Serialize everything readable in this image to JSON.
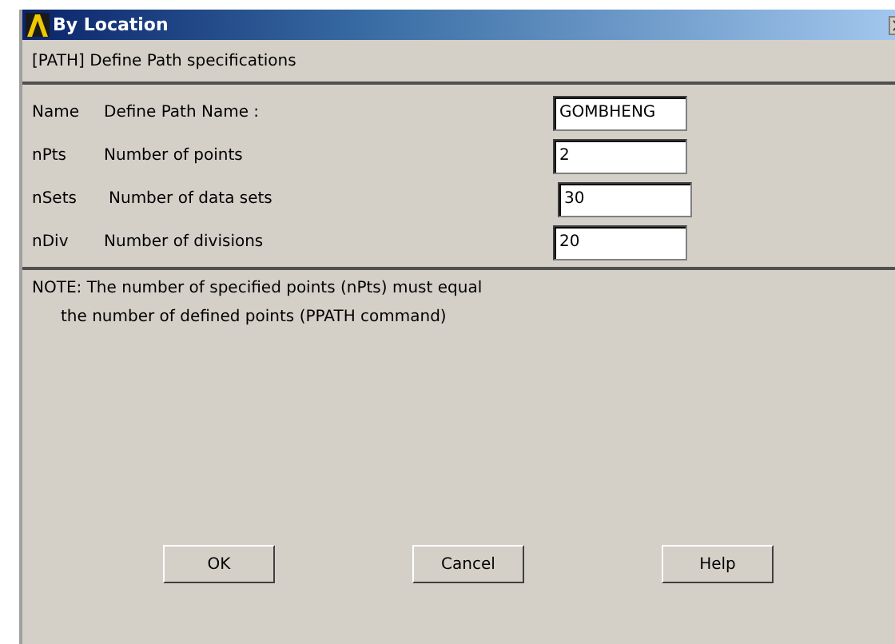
{
  "window": {
    "title": "By Location"
  },
  "header": "[PATH]  Define Path specifications",
  "fields": [
    {
      "key": "Name",
      "label": "Define Path Name :",
      "value": "GOMBHENG"
    },
    {
      "key": "nPts",
      "label": "Number of points",
      "value": "2"
    },
    {
      "key": "nSets",
      "label": "Number of data sets",
      "value": "30"
    },
    {
      "key": "nDiv",
      "label": "Number of divisions",
      "value": "20"
    }
  ],
  "note": [
    "NOTE: The number of specified points (nPts) must equal",
    "the number of defined points (PPATH command)"
  ],
  "buttons": [
    "OK",
    "Cancel",
    "Help"
  ]
}
